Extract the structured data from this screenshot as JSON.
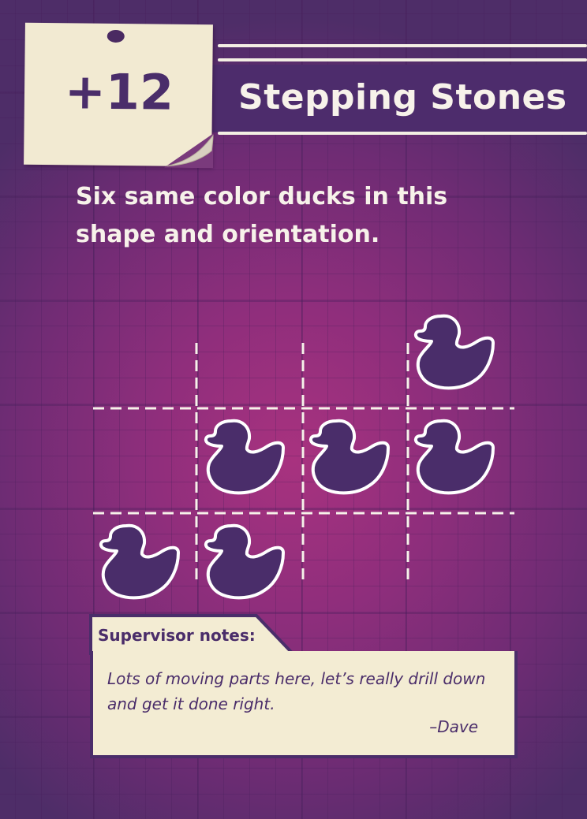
{
  "card": {
    "score": "+12",
    "title": "Stepping Stones",
    "description": "Six same color ducks in this shape and orientation."
  },
  "pattern": {
    "rows": 3,
    "cols": 4,
    "ducks": [
      [
        0,
        3
      ],
      [
        1,
        1
      ],
      [
        1,
        2
      ],
      [
        1,
        3
      ],
      [
        2,
        0
      ],
      [
        2,
        1
      ]
    ],
    "duck_color": "#4a2d6a",
    "outline_color": "#ffffff"
  },
  "supervisor": {
    "label": "Supervisor notes:",
    "note": "Lots of moving parts here, let’s really drill down and get it done right.",
    "signature": "–Dave"
  },
  "colors": {
    "background": "#8f2e7c",
    "accent": "#4a2d6a",
    "paper": "#f2ead2",
    "text_light": "#f7f2ea"
  }
}
